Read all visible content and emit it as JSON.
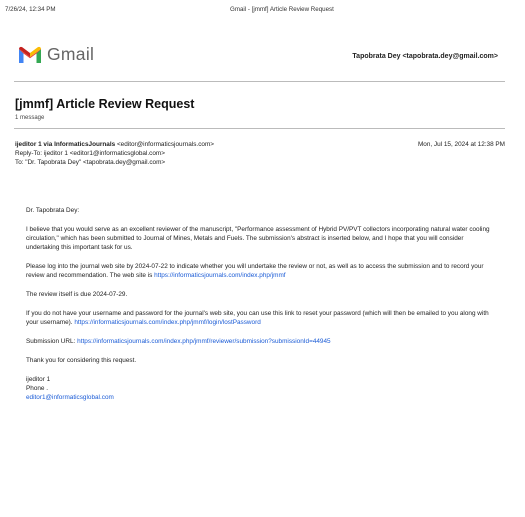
{
  "print_header": {
    "datetime": "7/26/24, 12:34 PM",
    "title": "Gmail - [jmmf] Article Review Request"
  },
  "brand": {
    "name": "Gmail",
    "colors": {
      "red": "#ea4335",
      "blue": "#4285f4",
      "green": "#34a853",
      "yellow": "#fbbc04"
    }
  },
  "account": "Tapobrata Dey <tapobrata.dey@gmail.com>",
  "subject": "[jmmf] Article Review Request",
  "message_count": "1 message",
  "email": {
    "from_name": "ijeditor 1 via InformaticsJournals",
    "from_email": "<editor@informaticsjournals.com>",
    "date": "Mon, Jul 15, 2024 at 12:38 PM",
    "reply_to": "Reply-To: ijeditor 1 <editor1@informaticsglobal.com>",
    "to": "To: \"Dr. Tapobrata Dey\" <tapobrata.dey@gmail.com>"
  },
  "body": {
    "greeting": "Dr. Tapobrata Dey:",
    "para1": "I believe that you would serve as an excellent reviewer of the manuscript, \"Performance assessment of Hybrid PV/PVT collectors incorporating natural water cooling circulation,\" which has been submitted to Journal of Mines, Metals and Fuels. The submission's abstract is inserted below, and I hope that you will consider undertaking this important task for us.",
    "para2_text": "Please log into the journal web site by 2024-07-22 to indicate whether you will undertake the review or not, as well as to access the submission and to record your review and recommendation. The web site is ",
    "para2_link": "https://informaticsjournals.com/index.php/jmmf",
    "para3": "The review itself is due 2024-07-29.",
    "para4_text": "If you do not have your username and password for the journal's web site, you can use this link to reset your password (which will then be emailed to you along with your username). ",
    "para4_link": "https://informaticsjournals.com/index.php/jmmf/login/lostPassword",
    "submission_label": "Submission URL: ",
    "submission_link": "https://informaticsjournals.com/index.php/jmmf/reviewer/submission?submissionId=44945",
    "thanks": "Thank you for considering this request.",
    "sig_name": "ijeditor 1",
    "sig_phone": "Phone .",
    "sig_email": "editor1@informaticsglobal.com"
  }
}
